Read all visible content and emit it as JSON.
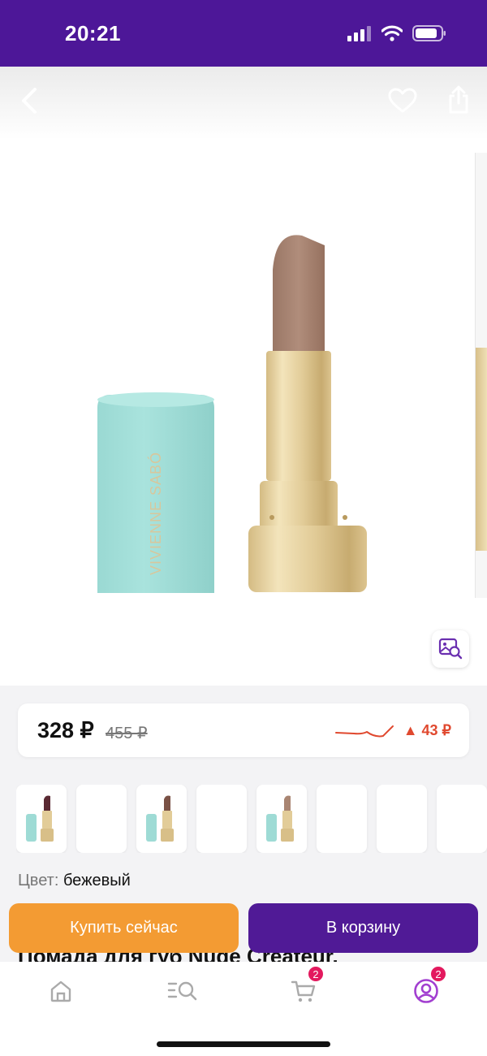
{
  "status": {
    "time": "20:21"
  },
  "product": {
    "price_current": "328 ₽",
    "price_old": "455 ₽",
    "price_change": "▲ 43 ₽",
    "color_label": "Цвет:",
    "color_value": "бежевый",
    "title_peek": "Помада для губ Nude Createur.",
    "thumbnails": [
      "dark-lipstick",
      "empty",
      "brown-lipstick",
      "empty",
      "beige-lipstick",
      "empty",
      "empty",
      "empty"
    ]
  },
  "actions": {
    "buy_now": "Купить сейчас",
    "add_to_cart": "В корзину"
  },
  "tabbar": {
    "cart_badge": "2",
    "profile_badge": "2"
  },
  "colors": {
    "brand_purple": "#501a96",
    "buy_orange": "#f39b33",
    "badge_red": "#e3195e",
    "price_change": "#e0492f"
  }
}
